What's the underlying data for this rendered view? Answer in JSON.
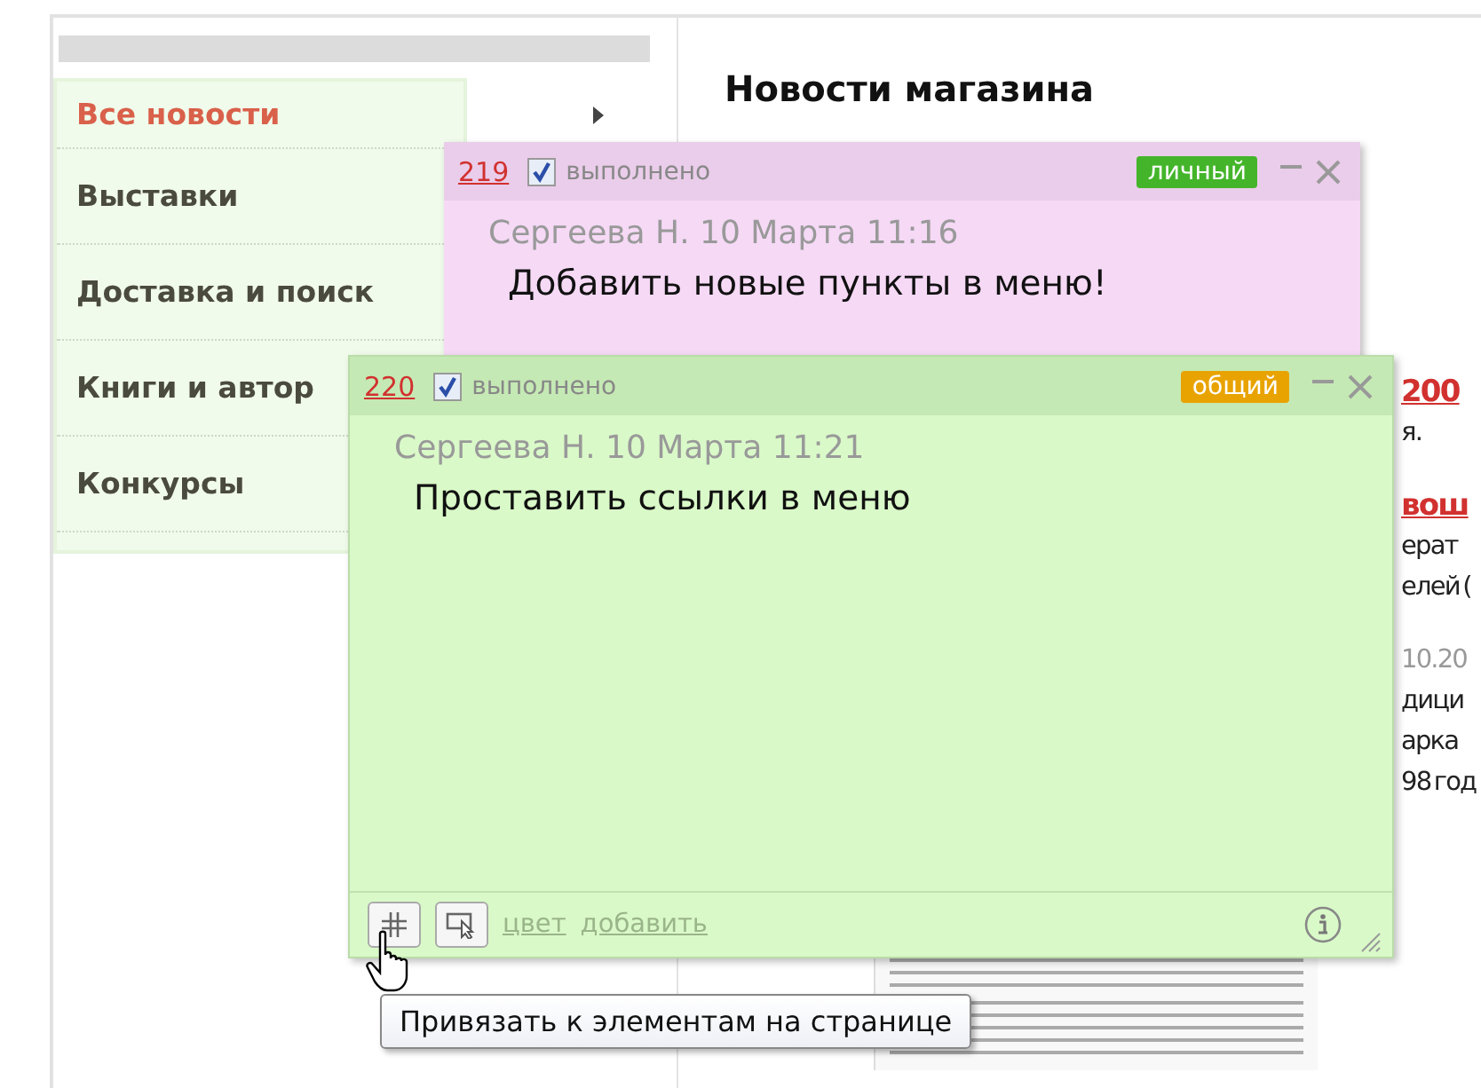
{
  "sidebar": {
    "items": [
      {
        "label": "Все новости",
        "selected": true
      },
      {
        "label": "Выставки",
        "selected": false
      },
      {
        "label": "Доставка и поиск",
        "selected": false
      },
      {
        "label": "Книги и автор",
        "selected": false
      },
      {
        "label": "Конкурсы",
        "selected": false
      }
    ]
  },
  "page": {
    "heading": "Новости магазина",
    "fragments": [
      {
        "kind": "link",
        "text": "200"
      },
      {
        "kind": "text",
        "text": "я."
      },
      {
        "kind": "link",
        "text": "вош"
      },
      {
        "kind": "text",
        "text": "ерат"
      },
      {
        "kind": "text",
        "text": "елей ("
      },
      {
        "kind": "date",
        "text": "10.20"
      },
      {
        "kind": "text",
        "text": "дици"
      },
      {
        "kind": "text",
        "text": "арка"
      },
      {
        "kind": "text",
        "text": "98 год"
      }
    ]
  },
  "notes": [
    {
      "number": "219",
      "done": true,
      "status_label": "выполнено",
      "tag": {
        "label": "личный",
        "color": "#44b52a"
      },
      "color": "#f5d9f5",
      "author_date": "Сергеева Н. 10 Марта 11:16",
      "text": "Добавить новые пункты в меню!"
    },
    {
      "number": "220",
      "done": true,
      "status_label": "выполнено",
      "tag": {
        "label": "общий",
        "color": "#e9a300"
      },
      "color": "#d9f9c8",
      "author_date": "Сергеева Н. 10 Марта 11:21",
      "text": "Проставить ссылки в меню",
      "footer": {
        "links": [
          "цвет",
          "добавить"
        ]
      }
    }
  ],
  "tooltip": "Привязать к элементам на странице"
}
